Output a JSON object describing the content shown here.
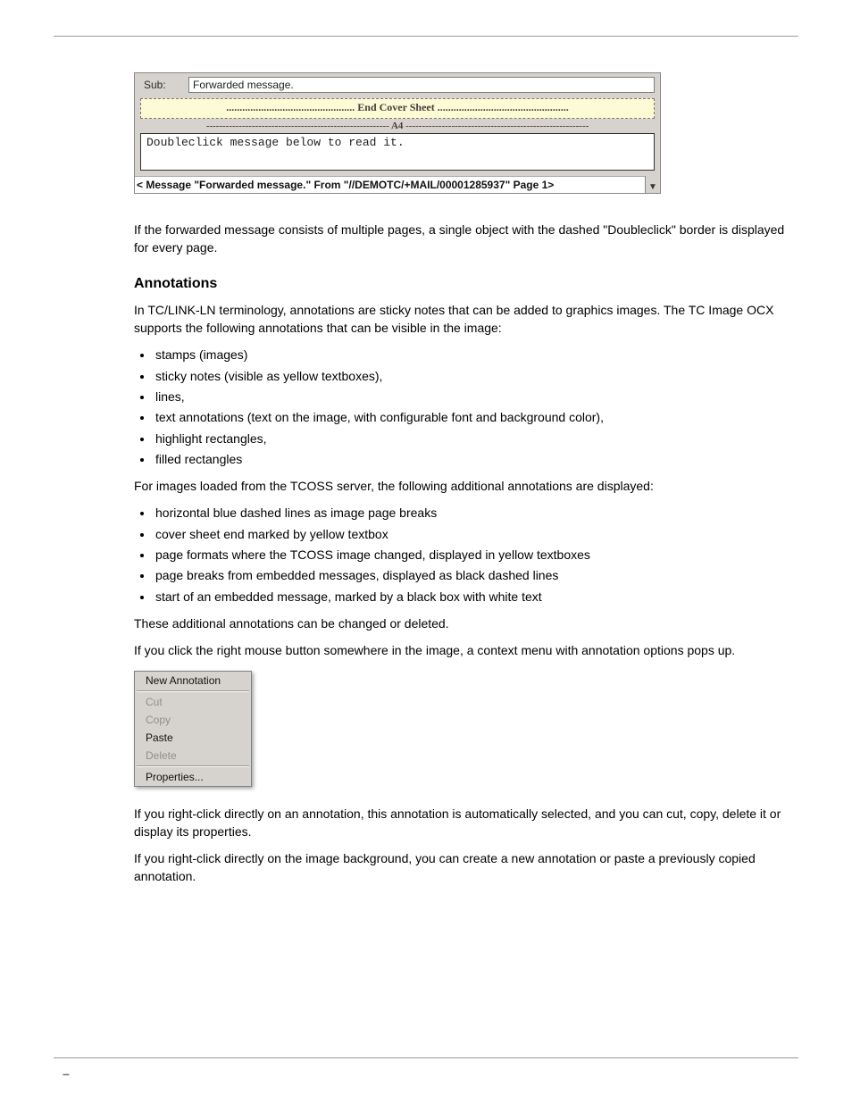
{
  "screenshot": {
    "sub_label": "Sub:",
    "sub_value": "Forwarded message.",
    "cover_line": "................................................  End Cover Sheet  .................................................",
    "a4_line": "--------------------------------------------------------  A4  --------------------------------------------------------",
    "dbl_text": "Doubleclick message below to read it.",
    "footer_text": "< Message \"Forwarded message.\" From \"//DEMOTC/+MAIL/00001285937\" Page 1>",
    "scroll_arrow": "▼"
  },
  "section1": {
    "intro": "If the forwarded message consists of multiple pages, a single object with the dashed \"Doubleclick\" border is displayed for every page.",
    "heading": "Annotations",
    "para1": "In TC/LINK-LN terminology, annotations are sticky notes that can be added to graphics images. The TC Image OCX supports the following annotations that can be visible in the image:",
    "list1": [
      "stamps (images)",
      "sticky notes (visible as yellow textboxes),",
      "lines,",
      "text annotations (text on the image, with configurable font and background color),",
      "highlight rectangles,",
      "filled rectangles"
    ],
    "para2": "For images loaded from the TCOSS server, the following additional annotations are displayed:",
    "list2": [
      "horizontal blue dashed lines as image page breaks",
      "cover sheet end marked by yellow textbox",
      "page formats where the TCOSS image changed, displayed in yellow textboxes",
      "page breaks from embedded messages, displayed as black dashed lines",
      "start of an embedded message, marked by a black box with white text"
    ],
    "para3": "These additional annotations can be changed or deleted.",
    "para4": "If you click the right mouse button somewhere in the image, a context menu with annotation options pops up."
  },
  "context_menu": {
    "items": [
      {
        "label": "New Annotation",
        "disabled": false
      },
      {
        "sep": true
      },
      {
        "label": "Cut",
        "disabled": true
      },
      {
        "label": "Copy",
        "disabled": true
      },
      {
        "label": "Paste",
        "disabled": false
      },
      {
        "label": "Delete",
        "disabled": true
      },
      {
        "sep": true
      },
      {
        "label": "Properties...",
        "disabled": false
      }
    ]
  },
  "after_menu": {
    "para1": "If you right-click directly on an annotation, this annotation is automatically selected, and you can cut, copy, delete it or display its properties.",
    "para2": "If you right-click directly on the image background, you can create a new annotation or paste a previously copied annotation."
  },
  "footer": {
    "dash": "–"
  }
}
